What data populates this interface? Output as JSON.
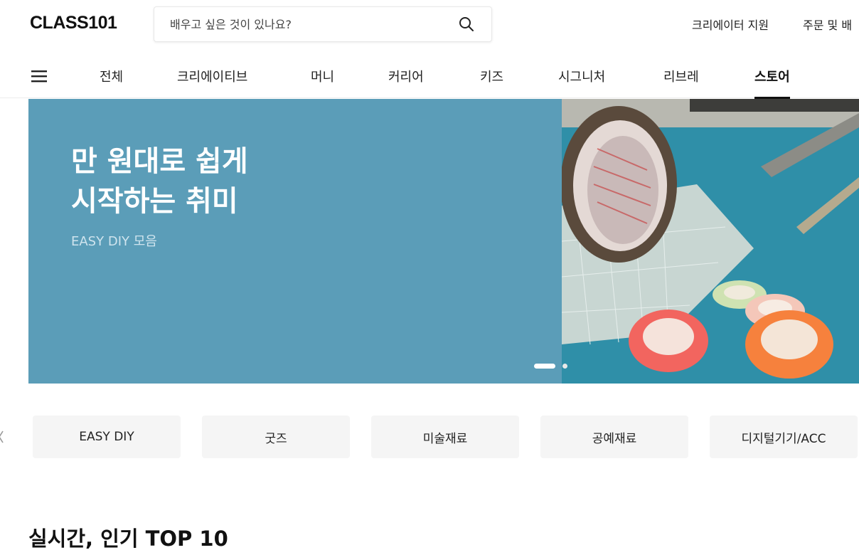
{
  "header": {
    "logo": "CLASS101",
    "search_placeholder": "배우고 싶은 것이 있나요?",
    "creator_support": "크리에이터 지원",
    "orders": "주문 및 배"
  },
  "nav": {
    "tabs": [
      {
        "label": "전체"
      },
      {
        "label": "크리에이티브"
      },
      {
        "label": "머니"
      },
      {
        "label": "커리어"
      },
      {
        "label": "키즈"
      },
      {
        "label": "시그니처"
      },
      {
        "label": "리브레"
      },
      {
        "label": "스토어",
        "active": true
      }
    ]
  },
  "banner": {
    "title": "만 원대로 쉽게\n시작하는 취미",
    "subtitle": "EASY DIY 모음",
    "bg_color": "#5b9db8",
    "slides_total": 2,
    "slide_index": 1
  },
  "chips": [
    {
      "label": "EASY DIY"
    },
    {
      "label": "굿즈"
    },
    {
      "label": "미술재료"
    },
    {
      "label": "공예재료"
    },
    {
      "label": "디지털기기/ACC"
    }
  ],
  "section": {
    "title": "실시간, 인기 TOP 10"
  }
}
